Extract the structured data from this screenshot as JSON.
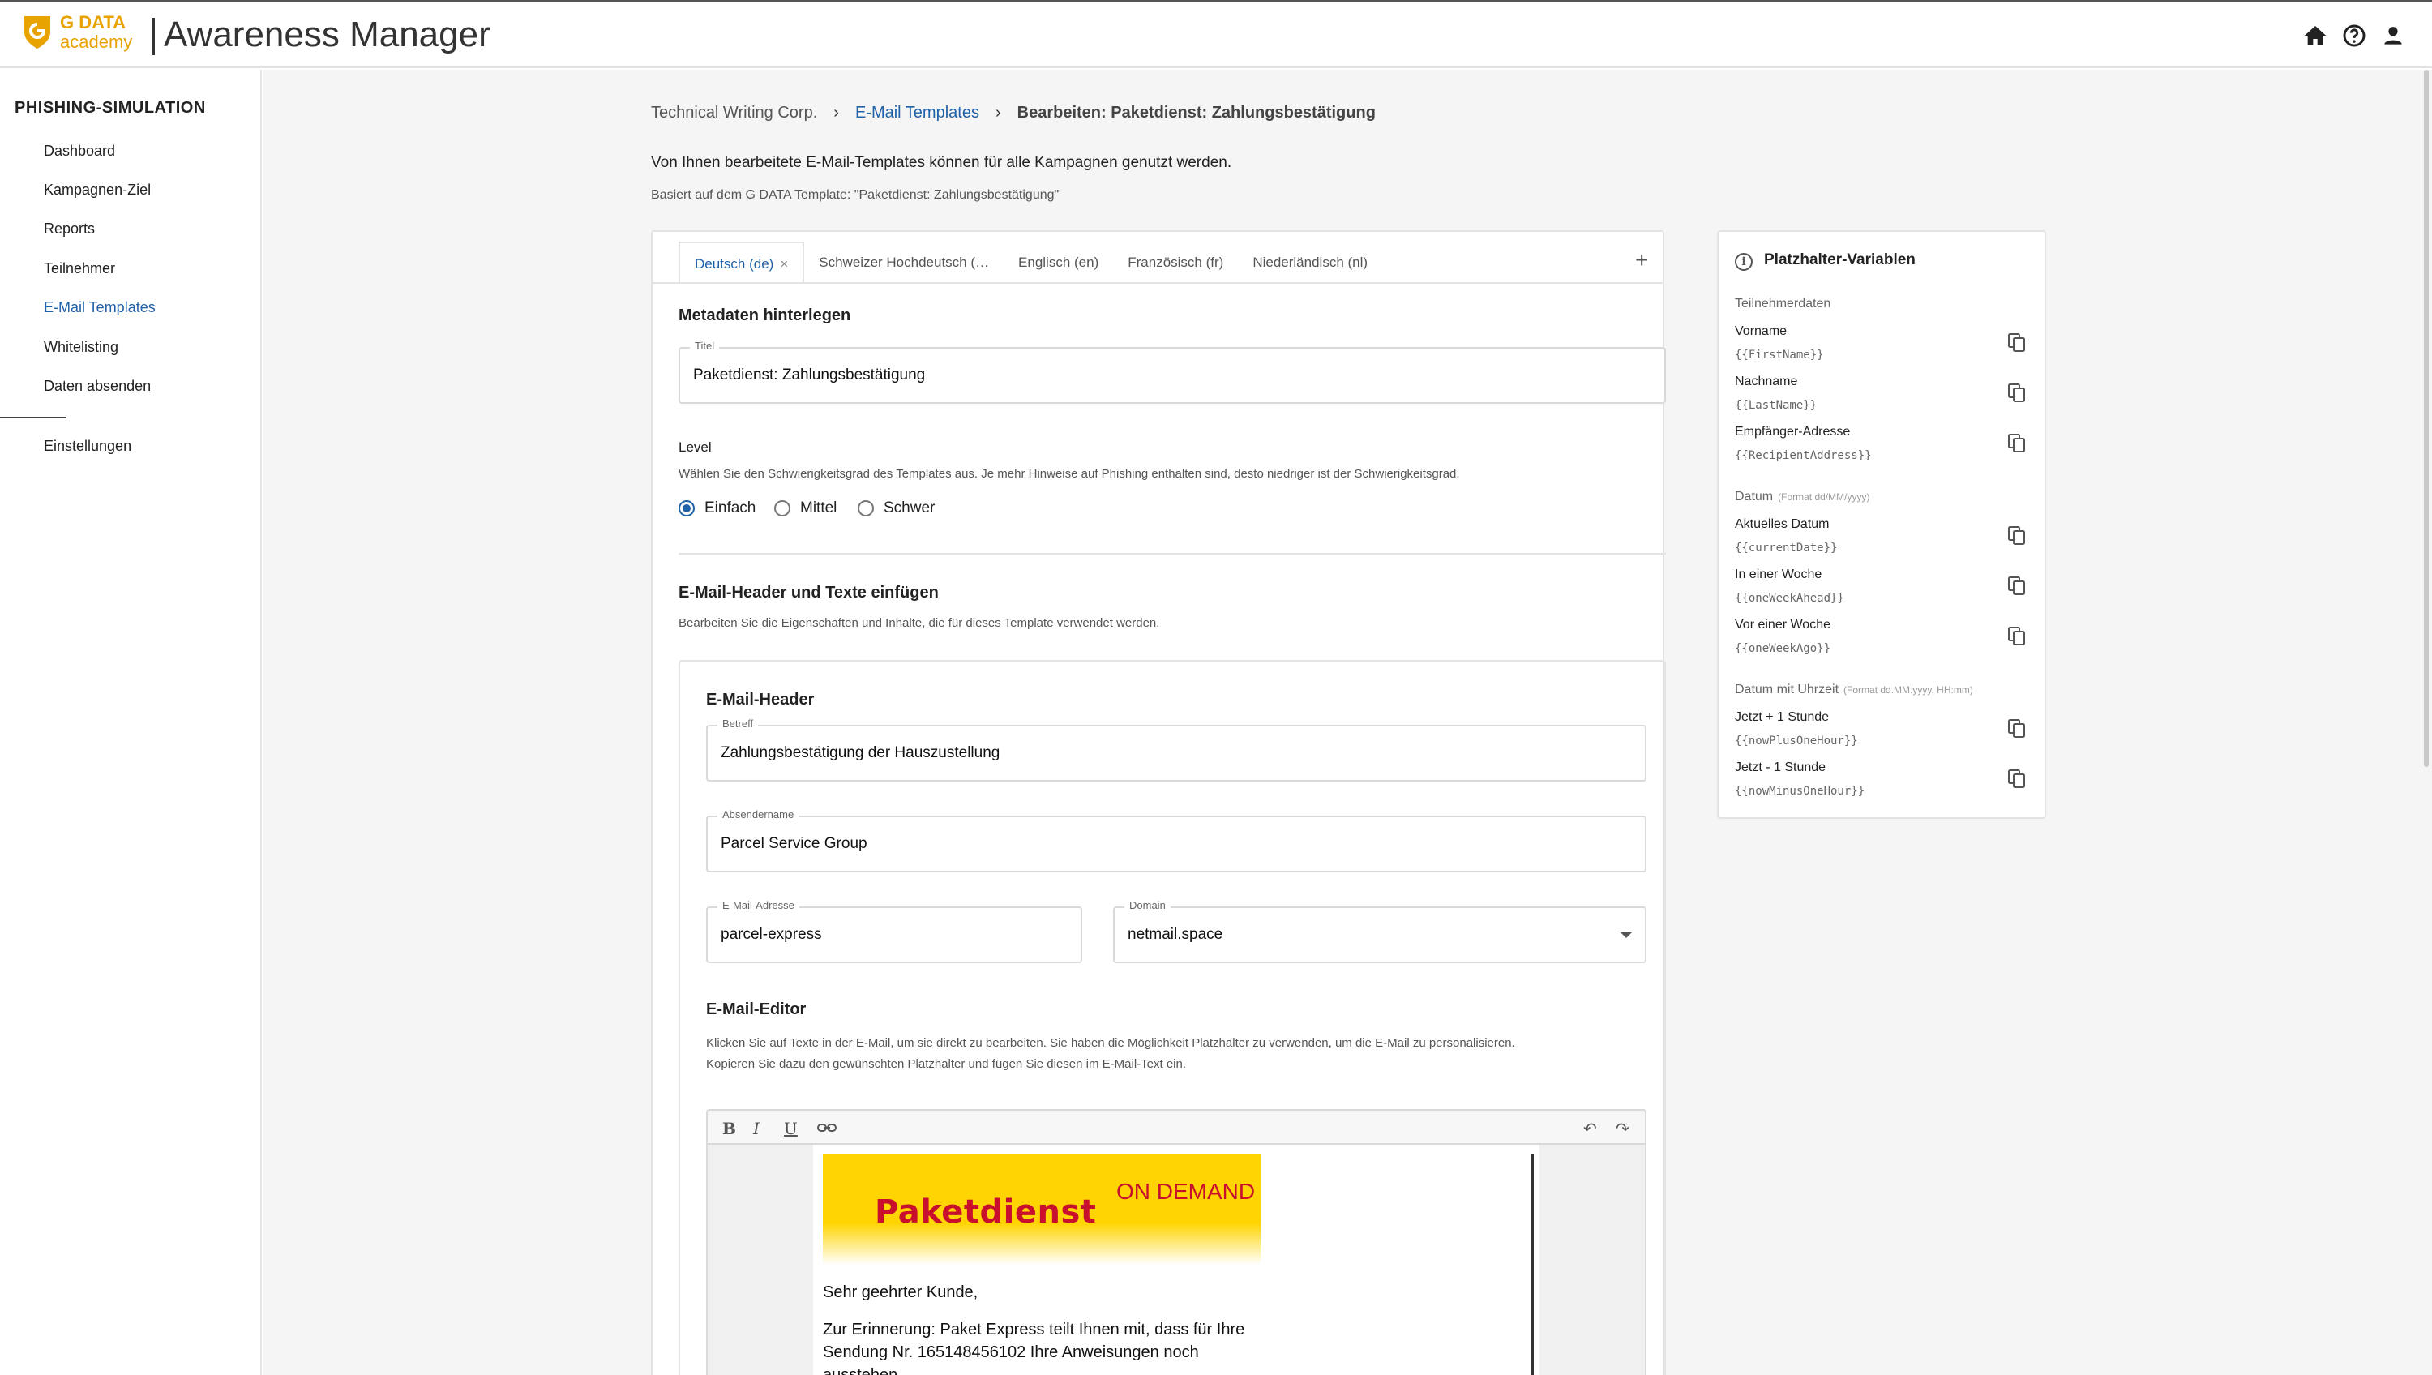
{
  "header": {
    "logo_line1": "G DATA",
    "logo_line2": "academy",
    "app_title": "Awareness Manager",
    "icons": [
      "home-icon",
      "help-icon",
      "user-icon"
    ]
  },
  "sidebar": {
    "heading": "PHISHING-SIMULATION",
    "items": [
      {
        "label": "Dashboard"
      },
      {
        "label": "Kampagnen-Ziel"
      },
      {
        "label": "Reports"
      },
      {
        "label": "Teilnehmer"
      },
      {
        "label": "E-Mail Templates"
      },
      {
        "label": "Whitelisting"
      },
      {
        "label": "Daten absenden"
      }
    ],
    "settings": "Einstellungen"
  },
  "breadcrumb": {
    "root": "Technical Writing Corp.",
    "link": "E-Mail Templates",
    "current": "Bearbeiten: Paketdienst: Zahlungsbestätigung"
  },
  "intro": "Von Ihnen bearbeitete E-Mail-Templates können für alle Kampagnen genutzt werden.",
  "subintro": "Basiert auf dem G DATA Template: \"Paketdienst: Zahlungsbestätigung\"",
  "tabs": [
    {
      "label": "Deutsch (de)",
      "close": "×"
    },
    {
      "label": "Schweizer Hochdeutsch (…"
    },
    {
      "label": "Englisch (en)"
    },
    {
      "label": "Französisch (fr)"
    },
    {
      "label": "Niederländisch (nl)"
    }
  ],
  "add_tab": "+",
  "metadata": {
    "title": "Metadaten hinterlegen",
    "titel_label": "Titel",
    "titel_value": "Paketdienst: Zahlungsbestätigung"
  },
  "level": {
    "label": "Level",
    "help": "Wählen Sie den Schwierigkeitsgrad des Templates aus. Je mehr Hinweise auf Phishing enthalten sind, desto niedriger ist der Schwierigkeitsgrad.",
    "options": [
      "Einfach",
      "Mittel",
      "Schwer"
    ],
    "selected": "Einfach"
  },
  "mailsection": {
    "title": "E-Mail-Header und Texte einfügen",
    "help": "Bearbeiten Sie die Eigenschaften und Inhalte, die für dieses Template verwendet werden."
  },
  "mailheader": {
    "title": "E-Mail-Header",
    "betreff_label": "Betreff",
    "betreff_value": "Zahlungsbestätigung der Hauszustellung",
    "absender_label": "Absendername",
    "absender_value": "Parcel Service Group",
    "adresse_label": "E-Mail-Adresse",
    "adresse_value": "parcel-express",
    "at": "@",
    "domain_label": "Domain",
    "domain_value": "netmail.space"
  },
  "editor": {
    "title": "E-Mail-Editor",
    "help1": "Klicken Sie auf Texte in der E-Mail, um sie direkt zu bearbeiten. Sie haben die Möglichkeit Platzhalter zu verwenden, um die E-Mail zu personalisieren.",
    "help2": "Kopieren Sie dazu den gewünschten Platzhalter und fügen Sie diesen im E-Mail-Text ein.",
    "toolbar": {
      "bold": "B",
      "italic": "I",
      "underline": "U",
      "undo": "↶",
      "redo": "↷"
    },
    "banner_title": "Paketdienst",
    "banner_sub": "ON DEMAND",
    "greeting": "Sehr geehrter Kunde,",
    "body1": "Zur Erinnerung: Paket Express teilt Ihnen mit, dass für Ihre",
    "body2": "Sendung Nr. 165148456102 Ihre Anweisungen noch",
    "body3": "ausstehen."
  },
  "panel": {
    "title": "Platzhalter-Variablen",
    "info": "i",
    "groups": [
      {
        "label": "Teilnehmerdaten",
        "hint": ""
      },
      {
        "label": "Datum",
        "hint": "(Format dd/MM/yyyy)"
      },
      {
        "label": "Datum mit Uhrzeit",
        "hint": "(Format dd.MM.yyyy, HH:mm)"
      }
    ],
    "vars": [
      {
        "name": "Vorname",
        "code": "{{FirstName}}"
      },
      {
        "name": "Nachname",
        "code": "{{LastName}}"
      },
      {
        "name": "Empfänger-Adresse",
        "code": "{{RecipientAddress}}"
      },
      {
        "name": "Aktuelles Datum",
        "code": "{{currentDate}}"
      },
      {
        "name": "In einer Woche",
        "code": "{{oneWeekAhead}}"
      },
      {
        "name": "Vor einer Woche",
        "code": "{{oneWeekAgo}}"
      },
      {
        "name": "Jetzt + 1 Stunde",
        "code": "{{nowPlusOneHour}}"
      },
      {
        "name": "Jetzt - 1 Stunde",
        "code": "{{nowMinusOneHour}}"
      }
    ]
  },
  "colors": {
    "accent": "#2062a8",
    "brand": "#e8a300",
    "banner_yellow": "#ffd400",
    "banner_red": "#c8102e"
  }
}
